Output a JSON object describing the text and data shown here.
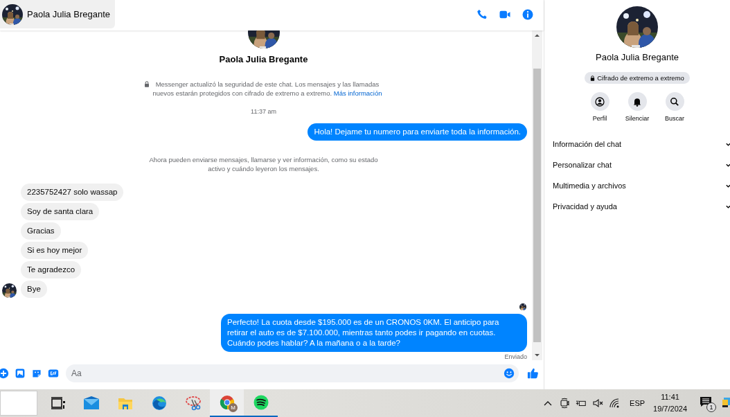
{
  "chat_header": {
    "name": "Paola Julia Bregante"
  },
  "conversation": {
    "contact_name": "Paola Julia Bregante",
    "messages": [
      {
        "kind": "notice",
        "locked": true,
        "text": "Messenger actualizó la seguridad de este chat. Los mensajes y las llamadas nuevos estarán protegidos con cifrado de extremo a extremo.",
        "link": "Más información"
      },
      {
        "kind": "time",
        "text": "11:37 am"
      },
      {
        "kind": "outgoing",
        "text": "Hola! Dejame tu numero  para enviarte toda la información."
      },
      {
        "kind": "notice",
        "locked": false,
        "text": "Ahora pueden enviarse mensajes, llamarse y ver información, como su estado activo y cuándo leyeron los mensajes."
      },
      {
        "kind": "incoming",
        "text": "2235752427 solo wassap",
        "avatar": false
      },
      {
        "kind": "incoming",
        "text": "Soy de santa clara",
        "avatar": false
      },
      {
        "kind": "incoming",
        "text": "Gracias",
        "avatar": false
      },
      {
        "kind": "incoming",
        "text": "Si es hoy mejor",
        "avatar": false
      },
      {
        "kind": "incoming",
        "text": "Te agradezco",
        "avatar": false
      },
      {
        "kind": "incoming",
        "text": "Bye",
        "avatar": true
      },
      {
        "kind": "seen"
      },
      {
        "kind": "outgoing",
        "text": "Perfecto! La cuota desde $195.000 es de un CRONOS 0KM. El anticipo para retirar el auto es de $7.100.000, mientras tanto podes ir pagando en cuotas. Cuándo podes hablar? A la mañana o a la tarde?"
      },
      {
        "kind": "status",
        "text": "Enviado"
      }
    ]
  },
  "composer": {
    "placeholder": "Aa"
  },
  "details": {
    "name": "Paola Julia Bregante",
    "encryption_badge": "Cifrado de extremo a extremo",
    "actions": [
      {
        "kind": "profile",
        "label": "Perfil"
      },
      {
        "kind": "mute",
        "label": "Silenciar"
      },
      {
        "kind": "search",
        "label": "Buscar"
      }
    ],
    "sections": [
      {
        "label": "Información del chat",
        "expanded": false
      },
      {
        "label": "Personalizar chat",
        "expanded": false
      },
      {
        "label": "Multimedia y archivos",
        "expanded": false
      },
      {
        "label": "Privacidad y ayuda",
        "expanded": false
      }
    ]
  },
  "taskbar": {
    "apps": [
      {
        "kind": "task-view",
        "running": false,
        "selected": false
      },
      {
        "kind": "mail",
        "running": false,
        "selected": false
      },
      {
        "kind": "folder",
        "running": false,
        "selected": false
      },
      {
        "kind": "edge",
        "running": false,
        "selected": false
      },
      {
        "kind": "snip",
        "running": false,
        "selected": false
      },
      {
        "kind": "chrome",
        "running": true,
        "selected": true,
        "badge": "M"
      },
      {
        "kind": "spotify",
        "running": true,
        "selected": false
      }
    ],
    "tray": {
      "language": "ESP",
      "time": "11:41",
      "date": "19/7/2024",
      "notifications": "1"
    }
  }
}
